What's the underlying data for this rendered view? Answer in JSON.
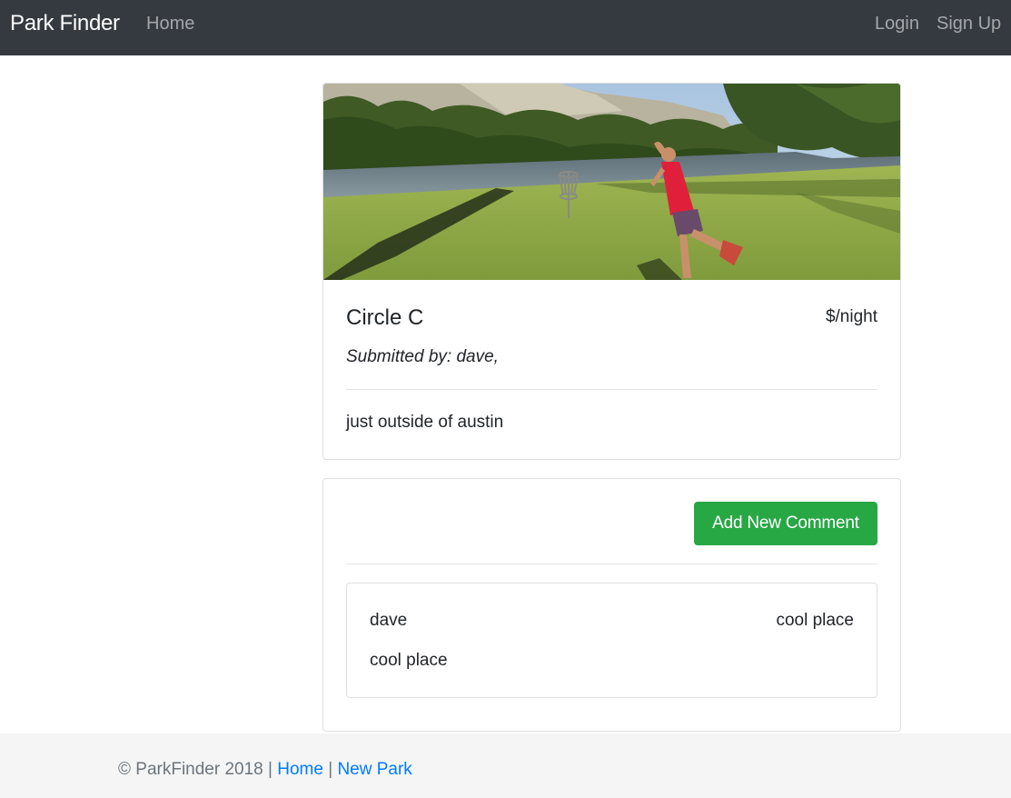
{
  "navbar": {
    "brand": "Park Finder",
    "home": "Home",
    "login": "Login",
    "signup": "Sign Up"
  },
  "park": {
    "image_alt": "disc golf player throwing near river",
    "title": "Circle C",
    "price": "$/night",
    "submitted_by": "Submitted by: dave,",
    "description": "just outside of austin"
  },
  "comments": {
    "add_button": "Add New Comment",
    "items": [
      {
        "author": "dave",
        "time": "cool place",
        "text": "cool place"
      }
    ]
  },
  "footer": {
    "copyright": "© ParkFinder 2018",
    "sep1": " | ",
    "home_link": "Home",
    "sep2": " | ",
    "new_park_link": "New Park"
  },
  "colors": {
    "navbar_bg": "#343a40",
    "success": "#28a745",
    "link": "#007bff",
    "footer_bg": "#f5f5f5"
  }
}
